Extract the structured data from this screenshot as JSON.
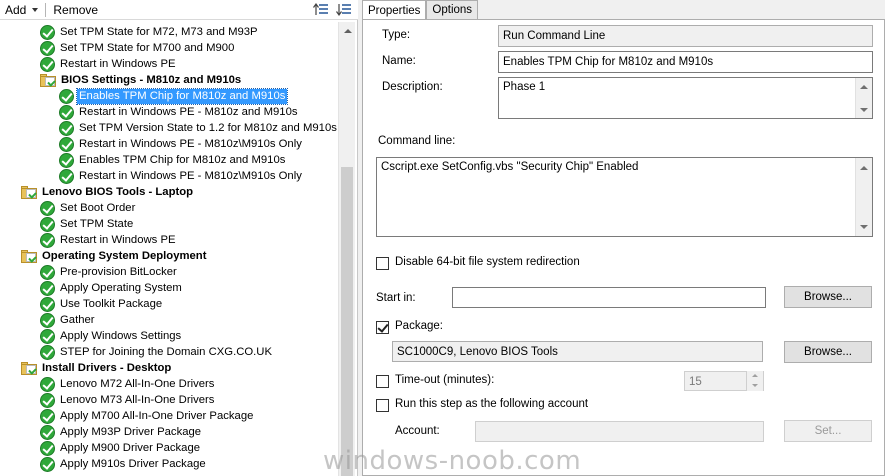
{
  "toolbar": {
    "add_label": "Add",
    "remove_label": "Remove",
    "icons": [
      "move-up-icon",
      "move-down-icon"
    ]
  },
  "tree": {
    "rows": [
      {
        "label": "Set TPM State for M72, M73 and M93P",
        "kind": "step",
        "level": 2
      },
      {
        "label": "Set TPM State for M700 and M900",
        "kind": "step",
        "level": 2
      },
      {
        "label": "Restart in Windows PE",
        "kind": "step",
        "level": 2
      },
      {
        "label": "BIOS Settings - M810z and M910s",
        "kind": "group",
        "level": 2
      },
      {
        "label": "Enables TPM Chip for M810z and M910s",
        "kind": "step",
        "level": 3,
        "selected": true
      },
      {
        "label": "Restart in Windows PE - M810z and M910s",
        "kind": "step",
        "level": 3
      },
      {
        "label": "Set TPM Version State to 1.2  for M810z and M910s",
        "kind": "step",
        "level": 3
      },
      {
        "label": "Restart in Windows PE - M810z\\M910s Only",
        "kind": "step",
        "level": 3
      },
      {
        "label": "Enables TPM Chip for M810z and M910s",
        "kind": "step",
        "level": 3
      },
      {
        "label": "Restart in Windows PE - M810z\\M910s Only",
        "kind": "step",
        "level": 3
      },
      {
        "label": "Lenovo BIOS Tools - Laptop",
        "kind": "group",
        "level": 1
      },
      {
        "label": "Set Boot Order",
        "kind": "step",
        "level": 2
      },
      {
        "label": "Set TPM State",
        "kind": "step",
        "level": 2
      },
      {
        "label": "Restart in Windows PE",
        "kind": "step",
        "level": 2
      },
      {
        "label": "Operating System Deployment",
        "kind": "group",
        "level": 1
      },
      {
        "label": "Pre-provision BitLocker",
        "kind": "step",
        "level": 2
      },
      {
        "label": "Apply Operating System",
        "kind": "step",
        "level": 2
      },
      {
        "label": "Use Toolkit Package",
        "kind": "step",
        "level": 2
      },
      {
        "label": "Gather",
        "kind": "step",
        "level": 2
      },
      {
        "label": "Apply Windows Settings",
        "kind": "step",
        "level": 2
      },
      {
        "label": "STEP for Joining the Domain CXG.CO.UK",
        "kind": "step",
        "level": 2
      },
      {
        "label": "Install Drivers - Desktop",
        "kind": "group",
        "level": 1
      },
      {
        "label": "Lenovo M72 All-In-One Drivers",
        "kind": "step",
        "level": 2
      },
      {
        "label": "Lenovo M73 All-In-One Drivers",
        "kind": "step",
        "level": 2
      },
      {
        "label": "Apply M700 All-In-One Driver Package",
        "kind": "step",
        "level": 2
      },
      {
        "label": "Apply M93P Driver Package",
        "kind": "step",
        "level": 2
      },
      {
        "label": "Apply M900 Driver Package",
        "kind": "step",
        "level": 2
      },
      {
        "label": "Apply M910s Driver Package",
        "kind": "step",
        "level": 2
      }
    ]
  },
  "tabs": [
    {
      "label": "Properties",
      "active": true
    },
    {
      "label": "Options",
      "active": false
    }
  ],
  "properties": {
    "type_label": "Type:",
    "type_value": "Run Command Line",
    "name_label": "Name:",
    "name_value": "Enables TPM Chip for M810z and M910s",
    "description_label": "Description:",
    "description_value": "Phase 1",
    "command_line_label": "Command line:",
    "command_line_value": "Cscript.exe SetConfig.vbs \"Security Chip\" Enabled",
    "disable_redirection_label": "Disable 64-bit file system redirection",
    "disable_redirection_checked": false,
    "start_in_label": "Start in:",
    "start_in_value": "",
    "browse_label": "Browse...",
    "package_label": "Package:",
    "package_checked": true,
    "package_value": "SC1000C9, Lenovo BIOS Tools",
    "timeout_label": "Time-out (minutes):",
    "timeout_checked": false,
    "timeout_value": "15",
    "run_as_label": "Run this step as the following account",
    "run_as_checked": false,
    "account_label": "Account:",
    "account_value": "",
    "set_label": "Set..."
  },
  "watermark": "windows-noob.com"
}
